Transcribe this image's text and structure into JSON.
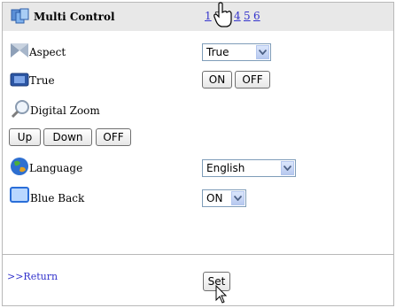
{
  "header": {
    "title": "Multi Control",
    "current_page": "2",
    "pages": [
      "1",
      "3",
      "4",
      "5",
      "6"
    ]
  },
  "rows": {
    "aspect": {
      "label": "Aspect",
      "selected": "True"
    },
    "true": {
      "label": "True",
      "on": "ON",
      "off": "OFF"
    },
    "digital_zoom": {
      "label": "Digital Zoom",
      "up": "Up",
      "down": "Down",
      "off": "OFF"
    },
    "language": {
      "label": "Language",
      "selected": "English"
    },
    "blue_back": {
      "label": "Blue Back",
      "selected": "ON"
    }
  },
  "footer": {
    "return_label": ">>Return",
    "set_label": "Set"
  },
  "colors": {
    "header_bg": "#e8e8e8",
    "link": "#3333cc",
    "border": "#b8b8b8"
  },
  "icons": [
    "multi-control-icon",
    "aspect-icon",
    "true-icon",
    "magnifier-icon",
    "globe-icon",
    "blue-back-icon",
    "hand-cursor-icon",
    "arrow-cursor-icon"
  ]
}
